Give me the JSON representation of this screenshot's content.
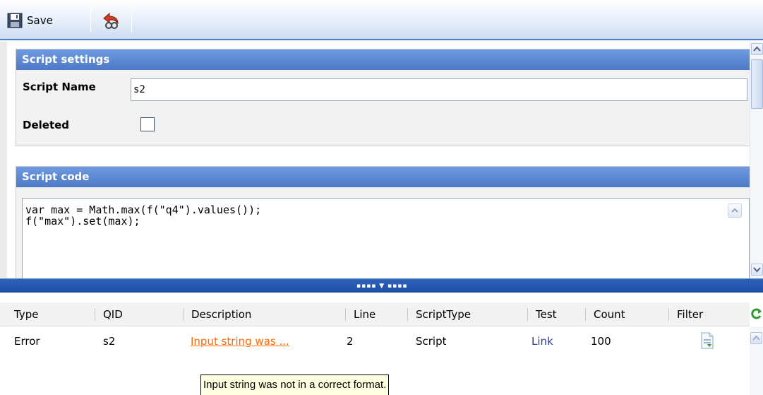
{
  "toolbar": {
    "save_label": "Save"
  },
  "settings": {
    "header": "Script settings",
    "name_label": "Script Name",
    "name_value": "s2",
    "deleted_label": "Deleted"
  },
  "code": {
    "header": "Script code",
    "text": "var max = Math.max(f(\"q4\").values());\nf(\"max\").set(max);"
  },
  "grid": {
    "columns": [
      "Type",
      "QID",
      "Description",
      "Line",
      "ScriptType",
      "Test",
      "Count",
      "Filter"
    ],
    "rows": [
      {
        "type": "Error",
        "qid": "s2",
        "description": "Input string was ...",
        "line": "2",
        "script_type": "Script",
        "test": "Link",
        "count": "100"
      }
    ]
  },
  "tooltip": "Input string was not in a correct format.",
  "colors": {
    "header_blue": "#4c78c7",
    "error_link": "#ff6a00",
    "link_blue": "#2d3b9c"
  }
}
